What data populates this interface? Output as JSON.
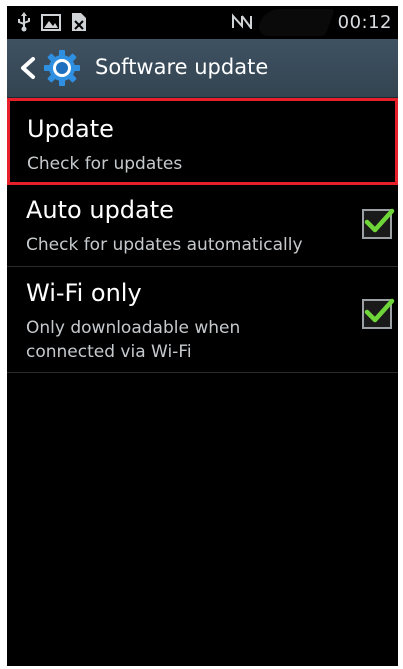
{
  "status_bar": {
    "time": "00:12",
    "left_icons": [
      "usb-icon",
      "image-icon",
      "file-icon"
    ],
    "right_icons": [
      "no-signal-icon"
    ]
  },
  "action_bar": {
    "title": "Software update",
    "back_icon": "chevron-left-icon",
    "app_icon": "gear-icon"
  },
  "settings": {
    "update": {
      "title": "Update",
      "summary": "Check for updates",
      "highlighted": true
    },
    "auto_update": {
      "title": "Auto update",
      "summary": "Check for updates automatically",
      "checked": true
    },
    "wifi_only": {
      "title": "Wi-Fi only",
      "summary": "Only downloadable when connected via Wi-Fi",
      "checked": true
    }
  },
  "colors": {
    "action_bar": "#3a4c5a",
    "highlight": "#e5202a",
    "check": "#6fd63a",
    "gear": "#2f8fe0"
  }
}
